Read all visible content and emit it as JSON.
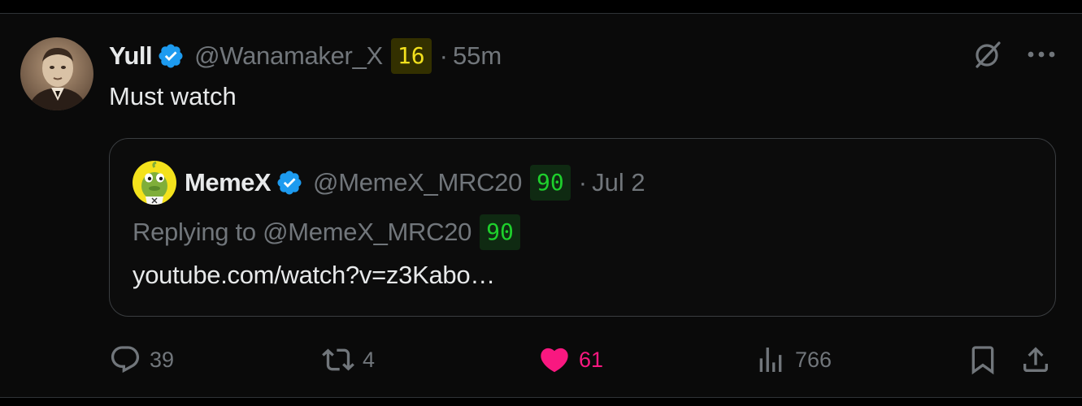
{
  "tweet": {
    "author_name": "Yull",
    "author_handle": "@Wanamaker_X",
    "author_badge": "16",
    "separator": "·",
    "time": "55m",
    "text": "Must watch",
    "avatar_icon": "profile-photo-sepia"
  },
  "quoted": {
    "author_name": "MemeX",
    "author_handle": "@MemeX_MRC20",
    "author_badge": "90",
    "separator": "·",
    "date": "Jul 2",
    "reply_label": "Replying to @MemeX_MRC20",
    "reply_badge": "90",
    "link_text": "youtube.com/watch?v=z3Kabo…",
    "avatar_icon": "frog-avatar"
  },
  "actions": {
    "replies": "39",
    "reposts": "4",
    "likes": "61",
    "views": "766"
  },
  "colors": {
    "background": "#0a0a0a",
    "verified": "#1d9bf0",
    "like": "#f91880",
    "badge_yellow_text": "#f2e01d",
    "badge_green_text": "#1ecf2c",
    "muted": "#71767b"
  }
}
